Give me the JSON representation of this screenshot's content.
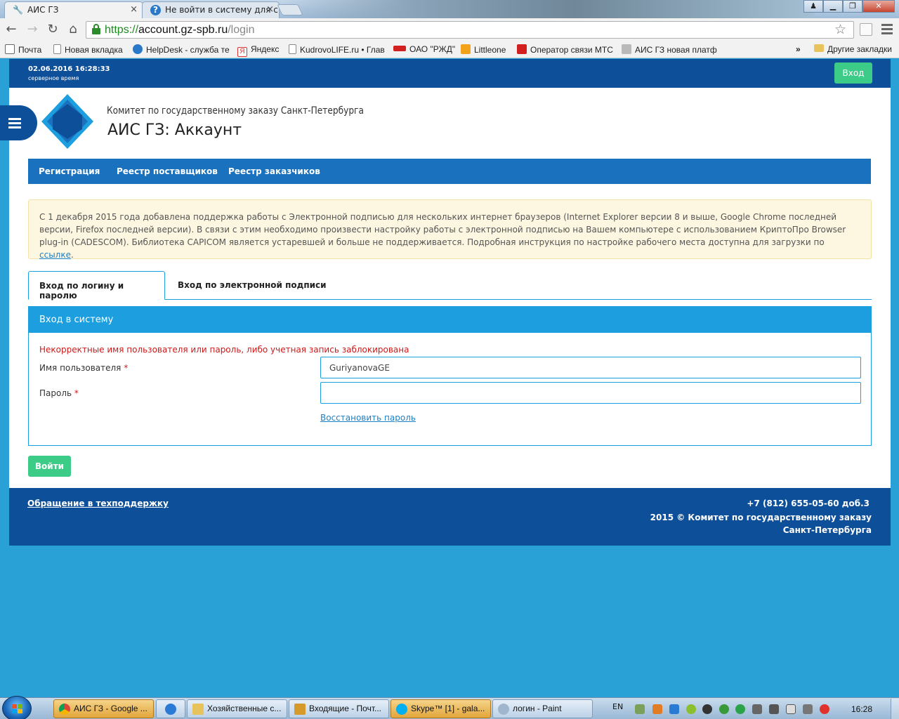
{
  "browser": {
    "tabs": [
      {
        "title": "АИС ГЗ",
        "close": "×"
      },
      {
        "title": "Не войти в систему для с",
        "close": "×"
      }
    ],
    "address": {
      "scheme": "https://",
      "host": "account.gz-spb.ru",
      "path": "/login"
    },
    "bookmarks": [
      "Почта",
      "Новая вкладка",
      "HelpDesk - служба те",
      "Яндекс",
      "KudrovoLIFE.ru • Глав",
      "ОАО \"РЖД\"",
      "Littleone",
      "Оператор связи МТС",
      "АИС ГЗ новая платф"
    ],
    "bookmarks_overflow": "»",
    "other_bookmarks": "Другие закладки",
    "window_buttons": {
      "minimize": "▁",
      "maximize": "❐",
      "close": "✕"
    }
  },
  "site": {
    "server_time": "02.06.2016 16:28:33",
    "server_time_label": "серверное время",
    "login_button": "Вход",
    "org_name": "Комитет по государственному заказу Санкт-Петербурга",
    "app_title": "АИС ГЗ: Аккаунт",
    "nav": [
      "Регистрация",
      "Реестр поставщиков",
      "Реестр заказчиков"
    ],
    "notice": {
      "text": "С 1 декабря 2015 года добавлена поддержка работы с Электронной подписью для нескольких интернет браузеров (Internet Explorer версии 8 и выше, Google Chrome последней версии, Firefox последней версии). В связи с этим необходимо произвести настройку работы с электронной подписью на Вашем компьютере с использованием КриптоПро Browser plug-in (CADESCOM). Библиотека CAPICOM является устаревшей и больше не поддерживается. Подробная инструкция по настройке рабочего места доступна для загрузки по ",
      "link": "ссылке",
      "tail": "."
    },
    "login_tabs": [
      "Вход по логину и паролю",
      "Вход по электронной подписи"
    ],
    "panel_title": "Вход в систему",
    "error": "Некорректные имя пользователя или пароль, либо учетная запись заблокирована",
    "username_label": "Имя пользователя",
    "username_value": "GuriyanovaGE",
    "password_label": "Пароль",
    "password_value": "",
    "required_mark": "*",
    "restore_link": "Восстановить пароль",
    "submit": "Войти",
    "footer": {
      "support": "Обращение в техподдержку",
      "phone": "+7 (812) 655-05-60 доб.3",
      "copyright": "2015 © Комитет по государственному заказу Санкт-Петербурга"
    }
  },
  "taskbar": {
    "items": [
      "АИС ГЗ - Google ...",
      "Хозяйственные с...",
      "Входящие - Почт...",
      "Skype™ [1] - gala...",
      "логин - Paint"
    ],
    "language": "EN",
    "clock": "16:28"
  },
  "colors": {
    "brand_blue": "#0e4f9a",
    "nav_blue": "#1a72bf",
    "panel_blue": "#1d9ede",
    "success_green": "#3dcc88",
    "error_red": "#d01818",
    "desktop_bg": "#29a0d6"
  }
}
